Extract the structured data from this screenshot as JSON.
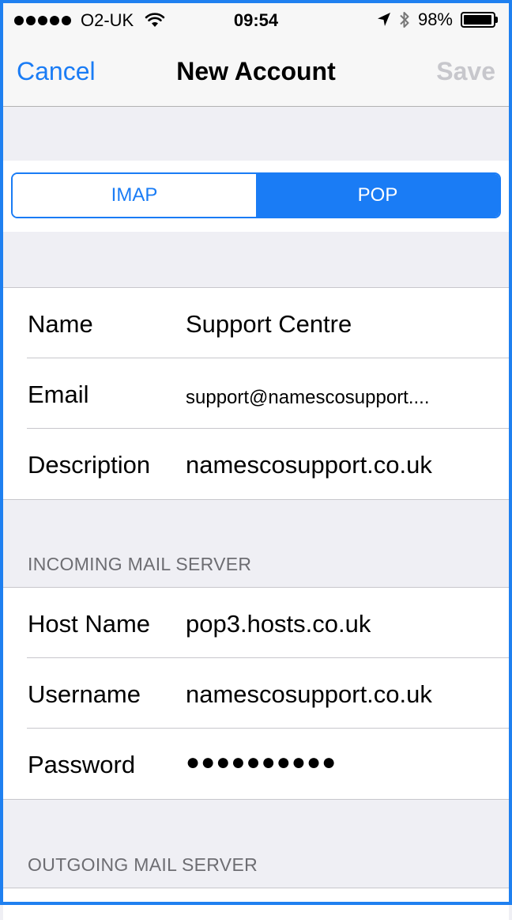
{
  "status_bar": {
    "carrier": "O2-UK",
    "time": "09:54",
    "battery_percent": "98%",
    "battery_level": 0.98,
    "icons": [
      "signal-dots",
      "wifi-icon",
      "location-arrow-icon",
      "bluetooth-icon",
      "battery-icon"
    ]
  },
  "nav": {
    "cancel_label": "Cancel",
    "title": "New Account",
    "save_label": "Save"
  },
  "segmented": {
    "options": [
      "IMAP",
      "POP"
    ],
    "selected": "POP"
  },
  "account": {
    "rows": [
      {
        "label": "Name",
        "value": "Support Centre"
      },
      {
        "label": "Email",
        "value": "support@namescosupport...."
      },
      {
        "label": "Description",
        "value": "namescosupport.co.uk"
      }
    ]
  },
  "incoming": {
    "header": "INCOMING MAIL SERVER",
    "rows": [
      {
        "label": "Host Name",
        "value": "pop3.hosts.co.uk"
      },
      {
        "label": "Username",
        "value": "namescosupport.co.uk"
      },
      {
        "label": "Password",
        "value": "●●●●●●●●●●"
      }
    ]
  },
  "outgoing": {
    "header": "OUTGOING MAIL SERVER"
  },
  "colors": {
    "accent": "#1a7cf5",
    "frame": "#1f80f0",
    "background": "#efeff4",
    "disabled": "#c7c7cc",
    "section_text": "#6d6d72"
  }
}
